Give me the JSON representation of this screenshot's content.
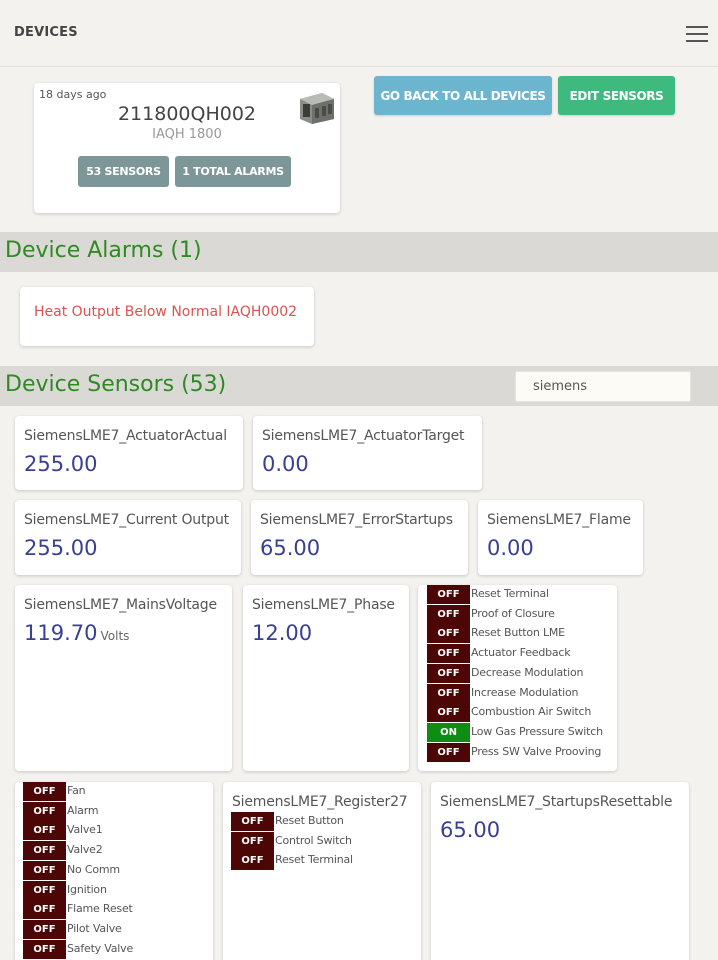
{
  "header": {
    "title": "DEVICES",
    "menu_icon": "hamburger-icon"
  },
  "device": {
    "updated": "18 days ago",
    "id": "211800QH002",
    "model": "IAQH 1800",
    "sensors_badge": "53 SENSORS",
    "alarms_badge": "1 TOTAL ALARMS"
  },
  "actions": {
    "back_label": "GO BACK TO ALL DEVICES",
    "edit_label": "EDIT SENSORS"
  },
  "alarms": {
    "heading": "Device Alarms (1)",
    "items": [
      "Heat Output Below Normal IAQH0002"
    ]
  },
  "sensors": {
    "heading": "Device Sensors (53)",
    "search_value": "siemens",
    "cards": [
      {
        "name": "SiemensLME7_ActuatorActual",
        "value": "255.00",
        "unit": ""
      },
      {
        "name": "SiemensLME7_ActuatorTarget",
        "value": "0.00",
        "unit": ""
      },
      {
        "name": "SiemensLME7_Current Output",
        "value": "255.00",
        "unit": ""
      },
      {
        "name": "SiemensLME7_ErrorStartups",
        "value": "65.00",
        "unit": ""
      },
      {
        "name": "SiemensLME7_Flame",
        "value": "0.00",
        "unit": ""
      },
      {
        "name": "SiemensLME7_MainsVoltage",
        "value": "119.70",
        "unit": "Volts"
      },
      {
        "name": "SiemensLME7_Phase",
        "value": "12.00",
        "unit": ""
      },
      {
        "name": "SiemensLME7_StartupsResettable",
        "value": "65.00",
        "unit": ""
      }
    ],
    "inputs_switches": [
      {
        "state": "OFF",
        "label": "Reset Terminal"
      },
      {
        "state": "OFF",
        "label": "Proof of Closure"
      },
      {
        "state": "OFF",
        "label": "Reset Button LME"
      },
      {
        "state": "OFF",
        "label": "Actuator Feedback"
      },
      {
        "state": "OFF",
        "label": "Decrease Modulation"
      },
      {
        "state": "OFF",
        "label": "Increase Modulation"
      },
      {
        "state": "OFF",
        "label": "Combustion Air Switch"
      },
      {
        "state": "ON",
        "label": "Low Gas Pressure Switch"
      },
      {
        "state": "OFF",
        "label": "Press SW Valve Prooving"
      }
    ],
    "outputs_switches": [
      {
        "state": "OFF",
        "label": "Fan"
      },
      {
        "state": "OFF",
        "label": "Alarm"
      },
      {
        "state": "OFF",
        "label": "Valve1"
      },
      {
        "state": "OFF",
        "label": "Valve2"
      },
      {
        "state": "OFF",
        "label": "No Comm"
      },
      {
        "state": "OFF",
        "label": "Ignition"
      },
      {
        "state": "OFF",
        "label": "Flame Reset"
      },
      {
        "state": "OFF",
        "label": "Pilot Valve"
      },
      {
        "state": "OFF",
        "label": "Safety Valve"
      }
    ],
    "register27": {
      "name": "SiemensLME7_Register27",
      "switches": [
        {
          "state": "OFF",
          "label": "Reset Button"
        },
        {
          "state": "OFF",
          "label": "Control Switch"
        },
        {
          "state": "OFF",
          "label": "Reset Terminal"
        }
      ]
    }
  },
  "colors": {
    "on": "#0f8d12",
    "off": "#4d0606",
    "accent": "#2f8a22",
    "value": "#3a3f93",
    "alarm": "#d9534f"
  }
}
